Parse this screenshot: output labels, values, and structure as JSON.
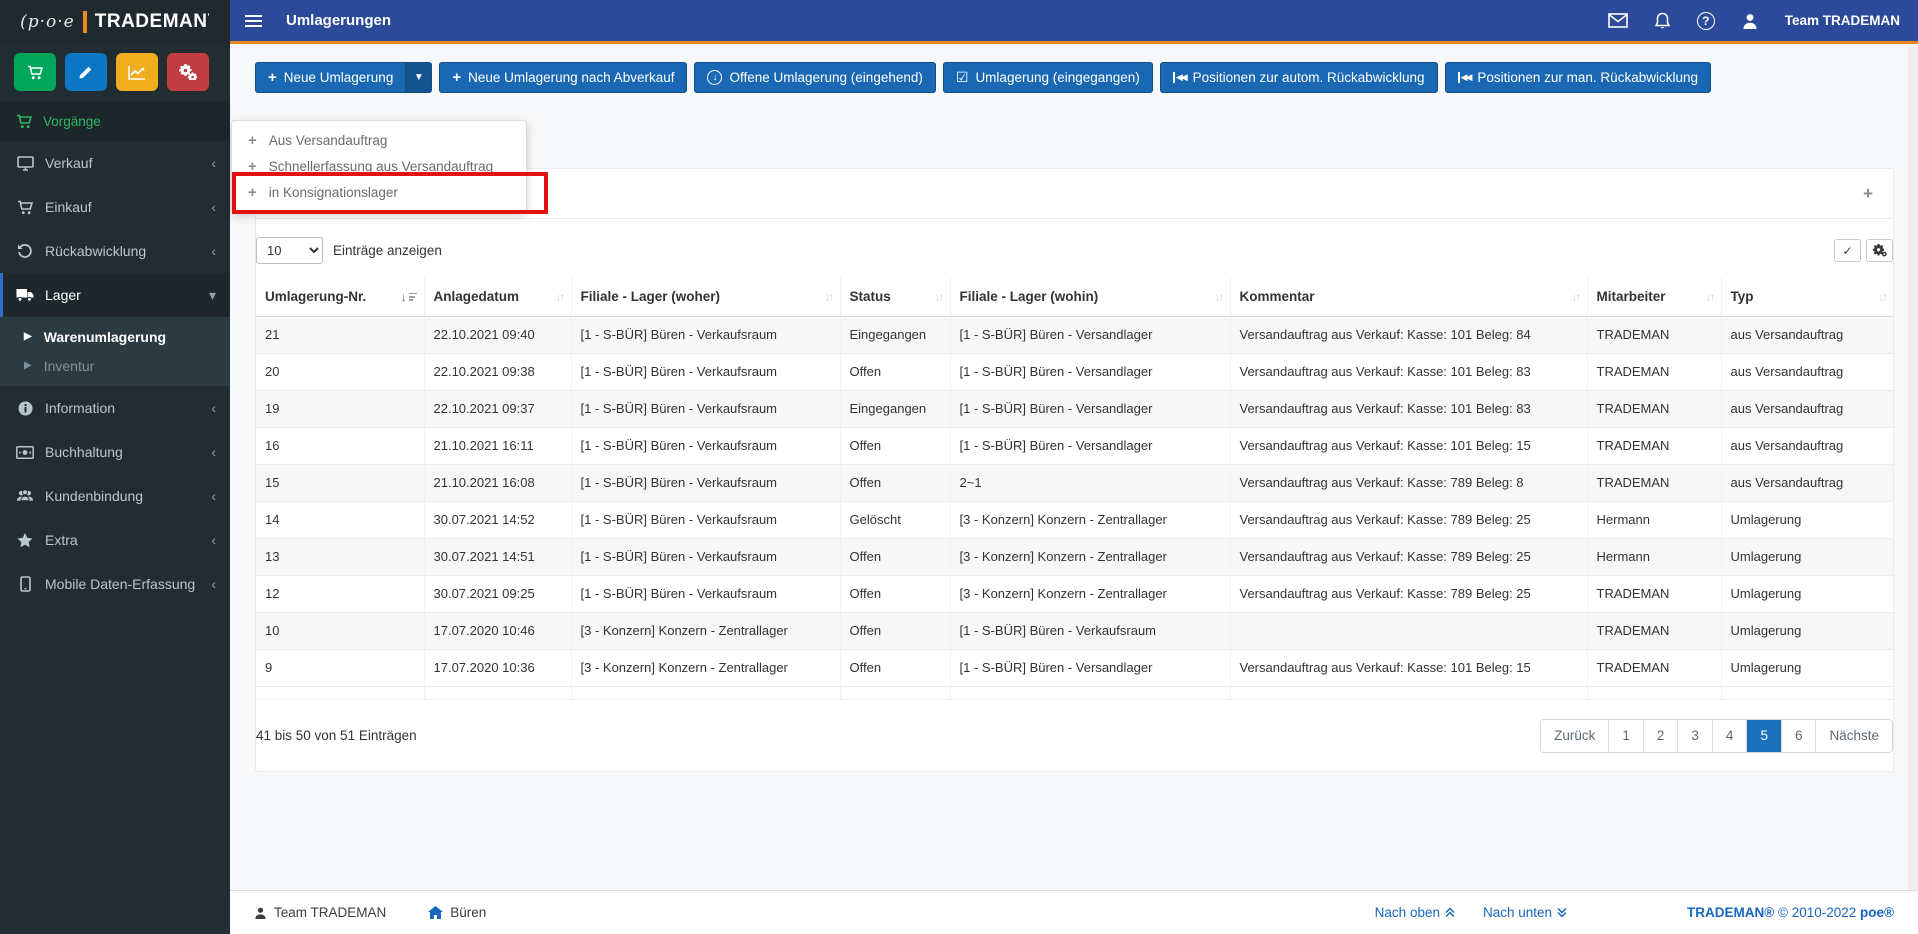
{
  "logo": {
    "prefix": "(p·o·e",
    "brand": "TRADEMAN"
  },
  "topbar": {
    "title": "Umlagerungen",
    "user": "Team TRADEMAN",
    "icons": [
      "mail-icon",
      "bell-icon",
      "help-icon",
      "user-icon"
    ]
  },
  "sidebar": {
    "app_buttons": [
      {
        "name": "cart-app-button",
        "icon": "cart",
        "color": "#00a65a"
      },
      {
        "name": "edit-app-button",
        "icon": "pencil",
        "color": "#0b76c4"
      },
      {
        "name": "chart-app-button",
        "icon": "chart",
        "color": "#f0ad1e"
      },
      {
        "name": "settings-app-button",
        "icon": "gears",
        "color": "#c13b42"
      }
    ],
    "header": "Vorgänge",
    "items": [
      {
        "label": "Verkauf",
        "icon": "monitor",
        "chevron": "left"
      },
      {
        "label": "Einkauf",
        "icon": "cart",
        "chevron": "left"
      },
      {
        "label": "Rückabwicklung",
        "icon": "undo",
        "chevron": "left"
      },
      {
        "label": "Lager",
        "icon": "truck",
        "chevron": "down",
        "active": true,
        "children": [
          {
            "label": "Warenumlagerung",
            "state": "current"
          },
          {
            "label": "Inventur",
            "state": "muted"
          }
        ]
      },
      {
        "label": "Information",
        "icon": "info",
        "chevron": "left"
      },
      {
        "label": "Buchhaltung",
        "icon": "money",
        "chevron": "left"
      },
      {
        "label": "Kundenbindung",
        "icon": "users",
        "chevron": "left"
      },
      {
        "label": "Extra",
        "icon": "star",
        "chevron": "left"
      },
      {
        "label": "Mobile Daten-Erfassung",
        "icon": "mobile",
        "chevron": "left"
      }
    ]
  },
  "toolbar": [
    {
      "label": "Neue Umlagerung",
      "icon": "plus",
      "split": true
    },
    {
      "label": "Neue Umlagerung nach Abverkauf",
      "icon": "plus"
    },
    {
      "label": "Offene Umlagerung (eingehend)",
      "icon": "arrow-circle-down"
    },
    {
      "label": "Umlagerung (eingegangen)",
      "icon": "check-square"
    },
    {
      "label": "Positionen zur autom. Rückabwicklung",
      "icon": "fast-backward"
    },
    {
      "label": "Positionen zur man. Rückabwicklung",
      "icon": "fast-backward"
    }
  ],
  "dropdown": {
    "items": [
      "Aus Versandauftrag",
      "Schnellerfassung aus Versandauftrag",
      "in Konsignationslager"
    ],
    "annotated_item": "in Konsignationslager",
    "annotation_color": "#e01212"
  },
  "table_controls": {
    "length_value": "10",
    "length_label": "Einträge anzeigen"
  },
  "table": {
    "columns": [
      {
        "label": "Umlagerung-Nr.",
        "sort": "desc-active"
      },
      {
        "label": "Anlagedatum",
        "sort": "both"
      },
      {
        "label": "Filiale - Lager (woher)",
        "sort": "both"
      },
      {
        "label": "Status",
        "sort": "both"
      },
      {
        "label": "Filiale - Lager (wohin)",
        "sort": "both"
      },
      {
        "label": "Kommentar",
        "sort": "both"
      },
      {
        "label": "Mitarbeiter",
        "sort": "both"
      },
      {
        "label": "Typ",
        "sort": "both"
      }
    ],
    "rows": [
      {
        "nr": "21",
        "datum": "22.10.2021 09:40",
        "woher": "[1 - S-BÜR] Büren - Verkaufsraum",
        "status": "Eingegangen",
        "wohin": "[1 - S-BÜR] Büren - Versandlager",
        "kommentar": "Versandauftrag aus Verkauf: Kasse: 101 Beleg: 84",
        "mitarbeiter": "TRADEMAN",
        "typ": "aus Versandauftrag"
      },
      {
        "nr": "20",
        "datum": "22.10.2021 09:38",
        "woher": "[1 - S-BÜR] Büren - Verkaufsraum",
        "status": "Offen",
        "wohin": "[1 - S-BÜR] Büren - Versandlager",
        "kommentar": "Versandauftrag aus Verkauf: Kasse: 101 Beleg: 83",
        "mitarbeiter": "TRADEMAN",
        "typ": "aus Versandauftrag"
      },
      {
        "nr": "19",
        "datum": "22.10.2021 09:37",
        "woher": "[1 - S-BÜR] Büren - Verkaufsraum",
        "status": "Eingegangen",
        "wohin": "[1 - S-BÜR] Büren - Versandlager",
        "kommentar": "Versandauftrag aus Verkauf: Kasse: 101 Beleg: 83",
        "mitarbeiter": "TRADEMAN",
        "typ": "aus Versandauftrag"
      },
      {
        "nr": "16",
        "datum": "21.10.2021 16:11",
        "woher": "[1 - S-BÜR] Büren - Verkaufsraum",
        "status": "Offen",
        "wohin": "[1 - S-BÜR] Büren - Versandlager",
        "kommentar": "Versandauftrag aus Verkauf: Kasse: 101 Beleg: 15",
        "mitarbeiter": "TRADEMAN",
        "typ": "aus Versandauftrag"
      },
      {
        "nr": "15",
        "datum": "21.10.2021 16:08",
        "woher": "[1 - S-BÜR] Büren - Verkaufsraum",
        "status": "Offen",
        "wohin": "2~1",
        "kommentar": "Versandauftrag aus Verkauf: Kasse: 789 Beleg: 8",
        "mitarbeiter": "TRADEMAN",
        "typ": "aus Versandauftrag"
      },
      {
        "nr": "14",
        "datum": "30.07.2021 14:52",
        "woher": "[1 - S-BÜR] Büren - Verkaufsraum",
        "status": "Gelöscht",
        "wohin": "[3 - Konzern] Konzern - Zentrallager",
        "kommentar": "Versandauftrag aus Verkauf: Kasse: 789 Beleg: 25",
        "mitarbeiter": "Hermann",
        "typ": "Umlagerung"
      },
      {
        "nr": "13",
        "datum": "30.07.2021 14:51",
        "woher": "[1 - S-BÜR] Büren - Verkaufsraum",
        "status": "Offen",
        "wohin": "[3 - Konzern] Konzern - Zentrallager",
        "kommentar": "Versandauftrag aus Verkauf: Kasse: 789 Beleg: 25",
        "mitarbeiter": "Hermann",
        "typ": "Umlagerung"
      },
      {
        "nr": "12",
        "datum": "30.07.2021 09:25",
        "woher": "[1 - S-BÜR] Büren - Verkaufsraum",
        "status": "Offen",
        "wohin": "[3 - Konzern] Konzern - Zentrallager",
        "kommentar": "Versandauftrag aus Verkauf: Kasse: 789 Beleg: 25",
        "mitarbeiter": "TRADEMAN",
        "typ": "Umlagerung"
      },
      {
        "nr": "10",
        "datum": "17.07.2020 10:46",
        "woher": "[3 - Konzern] Konzern - Zentrallager",
        "status": "Offen",
        "wohin": "[1 - S-BÜR] Büren - Verkaufsraum",
        "kommentar": "",
        "mitarbeiter": "TRADEMAN",
        "typ": "Umlagerung"
      },
      {
        "nr": "9",
        "datum": "17.07.2020 10:36",
        "woher": "[3 - Konzern] Konzern - Zentrallager",
        "status": "Offen",
        "wohin": "[1 - S-BÜR] Büren - Versandlager",
        "kommentar": "Versandauftrag aus Verkauf: Kasse: 101 Beleg: 15",
        "mitarbeiter": "TRADEMAN",
        "typ": "Umlagerung"
      }
    ]
  },
  "info_text": "41 bis 50 von 51 Einträgen",
  "pagination": {
    "prev": "Zurück",
    "pages": [
      "1",
      "2",
      "3",
      "4",
      "5",
      "6"
    ],
    "active": "5",
    "next": "Nächste"
  },
  "footer": {
    "user": "Team TRADEMAN",
    "location": "Büren",
    "link_up": "Nach oben",
    "link_down": "Nach unten",
    "copyright_brand": "TRADEMAN®",
    "copyright_text": "© 2010-2022",
    "copyright_vendor": "poe®"
  },
  "colors": {
    "topbar": "#2b4a99",
    "accent_orange": "#e8891d",
    "sidebar": "#222d32",
    "button_blue": "#1a68b3",
    "pagination_active": "#1c72ba",
    "annotation_red": "#e01212",
    "link_blue": "#1766c0"
  }
}
